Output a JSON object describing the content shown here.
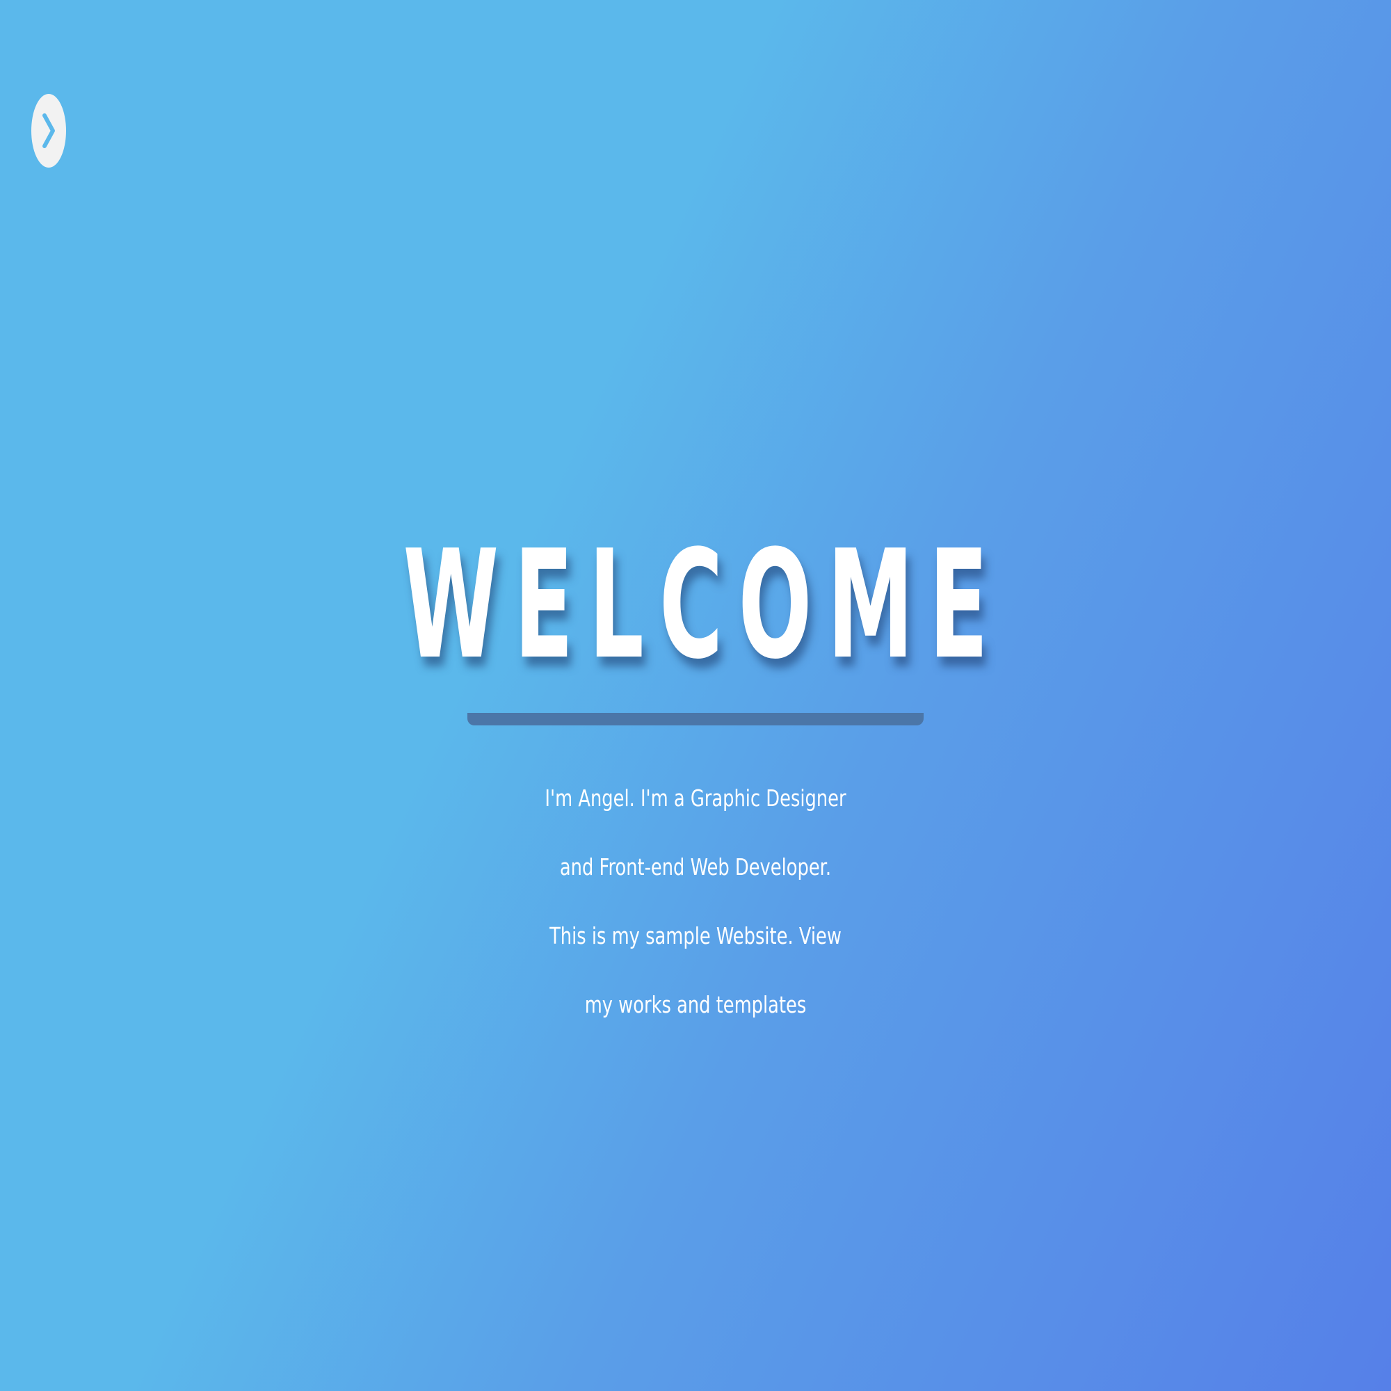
{
  "menu": {
    "icon": "chevron-right-icon",
    "toggle_color": "#f2f2f2",
    "icon_color": "#5bb8eb"
  },
  "hero": {
    "title": "WELCOME",
    "intro": "I'm Angel. I'm a Graphic Designer and Front-end Web Developer. This is my sample Website. View my works and templates"
  },
  "colors": {
    "background_start": "#5bb8eb",
    "background_end": "#5680e8",
    "rule": "#4b76a8",
    "text": "#ffffff"
  }
}
